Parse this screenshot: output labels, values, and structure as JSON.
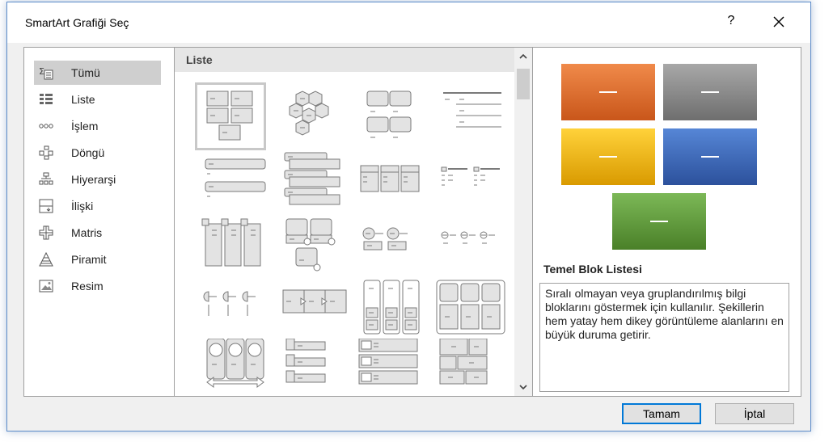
{
  "window": {
    "title": "SmartArt Grafiği Seç",
    "help_label": "?"
  },
  "categories": [
    {
      "label": "Tümü",
      "icon": "all-icon",
      "selected": true
    },
    {
      "label": "Liste",
      "icon": "list-icon"
    },
    {
      "label": "İşlem",
      "icon": "process-icon"
    },
    {
      "label": "Döngü",
      "icon": "cycle-icon"
    },
    {
      "label": "Hiyerarşi",
      "icon": "hierarchy-icon"
    },
    {
      "label": "İlişki",
      "icon": "relationship-icon"
    },
    {
      "label": "Matris",
      "icon": "matrix-icon"
    },
    {
      "label": "Piramit",
      "icon": "pyramid-icon"
    },
    {
      "label": "Resim",
      "icon": "picture-icon"
    }
  ],
  "gallery": {
    "header": "Liste"
  },
  "preview": {
    "title": "Temel Blok Listesi",
    "description": "Sıralı olmayan veya gruplandırılmış bilgi bloklarını göstermek için kullanılır. Şekillerin hem yatay hem dikey görüntüleme alanlarını en büyük duruma getirir.",
    "block_colors": [
      "#e06d26",
      "#8c8c8c",
      "#f3b800",
      "#3a67b5",
      "#5e9c3a"
    ],
    "block_text": "—"
  },
  "buttons": {
    "ok": "Tamam",
    "cancel": "İptal"
  }
}
